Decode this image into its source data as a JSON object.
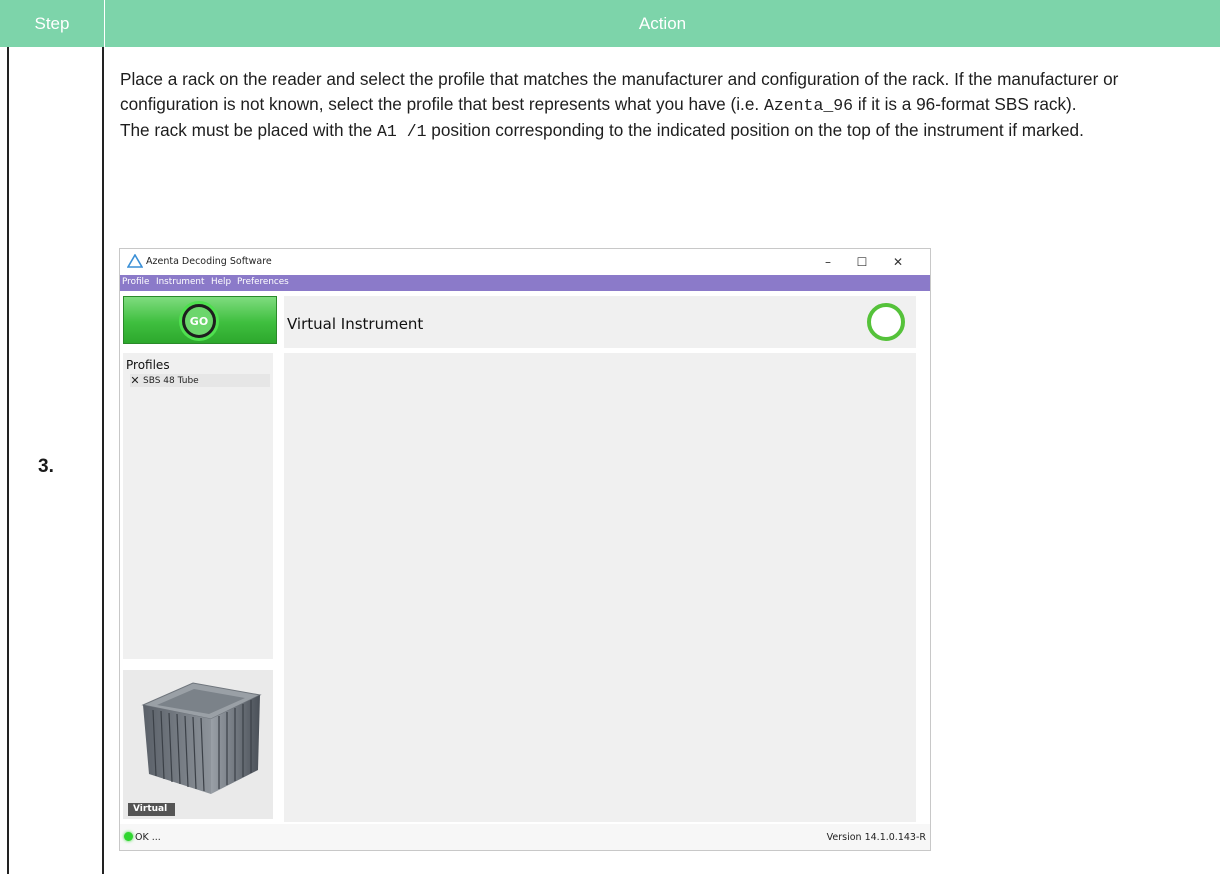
{
  "table": {
    "header": {
      "step": "Step",
      "action": "Action"
    },
    "row": {
      "step_number": "3.",
      "text": {
        "p1_a": "Place a rack on the reader and select the profile that matches the manufacturer and configuration of the rack. If the manufacturer or configuration is not known, select the profile that best represents what you have (i.e. ",
        "p1_code": "Azenta_96",
        "p1_b": " if it is a 96-format SBS rack).",
        "p2_a": "The rack must be placed with the ",
        "p2_code": "A1 /1",
        "p2_b": " position corresponding to the indicated position on the top of the instrument if marked."
      }
    }
  },
  "app": {
    "window_title": "Azenta Decoding Software",
    "window_controls": {
      "minimize": "–",
      "maximize": "☐",
      "close": "✕"
    },
    "menu": [
      "Profile",
      "Instrument",
      "Help",
      "Preferences"
    ],
    "go_label": "GO",
    "instrument_title": "Virtual Instrument",
    "profiles": {
      "label": "Profiles",
      "items": [
        {
          "label": "SBS 48 Tube",
          "mark": "✕"
        }
      ]
    },
    "device_badge": "Virtual",
    "status": {
      "text": "OK ...",
      "version": "Version 14.1.0.143-R"
    },
    "colors": {
      "header": "#7dd4aa",
      "menubar": "#8b7ac9",
      "go": "#3fbf3f",
      "ring": "#55c23a"
    },
    "icons": {
      "title": "azenta-logo-icon",
      "status": "status-led-icon",
      "device": "rack-reader-device-icon"
    }
  }
}
